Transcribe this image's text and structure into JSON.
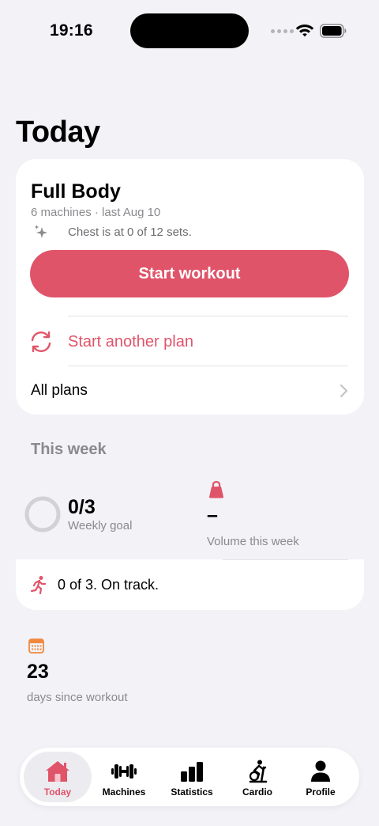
{
  "status_bar": {
    "time": "19:16"
  },
  "page": {
    "title": "Today"
  },
  "plan_card": {
    "name": "Full Body",
    "meta": "6 machines · last Aug 10",
    "hint": "Chest is at 0 of 12 sets.",
    "start_label": "Start workout",
    "another_plan_label": "Start another plan",
    "all_plans_label": "All plans"
  },
  "week": {
    "header": "This week",
    "goal_value": "0/3",
    "goal_progress": 0,
    "goal_label": "Weekly goal",
    "volume_value": "–",
    "volume_label": "Volume this week",
    "track_label": "0 of 3. On track."
  },
  "streak": {
    "days_value": "23",
    "days_label": "days since workout"
  },
  "tabs": [
    {
      "label": "Today",
      "icon": "house-icon",
      "active": true
    },
    {
      "label": "Machines",
      "icon": "dumbbell-icon",
      "active": false
    },
    {
      "label": "Statistics",
      "icon": "bar-chart-icon",
      "active": false
    },
    {
      "label": "Cardio",
      "icon": "exercise-bike-icon",
      "active": false
    },
    {
      "label": "Profile",
      "icon": "person-icon",
      "active": false
    }
  ],
  "colors": {
    "accent": "#e0546a",
    "background": "#f2f2f7",
    "card": "#ffffff",
    "secondary_text": "#8a8a8e",
    "calendar": "#f0883e"
  }
}
